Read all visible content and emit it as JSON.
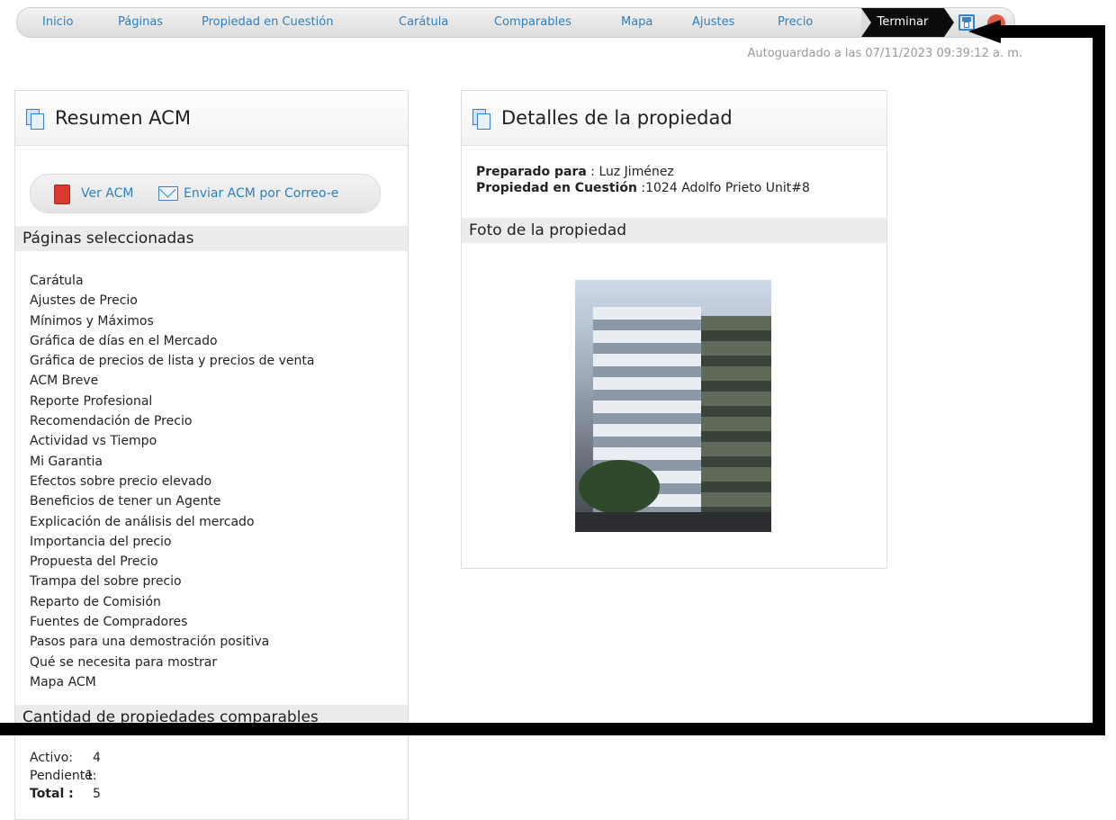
{
  "wizard": {
    "steps": [
      "Inicio",
      "Páginas",
      "Propiedad en Cuestión",
      "Carátula",
      "Comparables",
      "Mapa",
      "Ajustes",
      "Precio"
    ],
    "current": "Terminar",
    "save_icon": "save-icon",
    "close_icon": "close-icon"
  },
  "autosave": "Autoguardado a las 07/11/2023 09:39:12 a. m.",
  "summary": {
    "title": "Resumen ACM",
    "view_label": "Ver ACM",
    "email_label": "Enviar ACM por Correo-e",
    "pages_heading": "Páginas seleccionadas",
    "pages": [
      "Carátula",
      "Ajustes de Precio",
      "Mínimos y Máximos",
      "Gráfica de días en el Mercado",
      "Gráfica de precios de lista y precios de venta",
      "ACM Breve",
      "Reporte Profesional",
      "Recomendación de Precio",
      "Actividad vs Tiempo",
      "Mi Garantia",
      "Efectos sobre precio elevado",
      "Beneficios de tener un Agente",
      "Explicación de análisis del mercado",
      "Importancia del precio",
      "Propuesta del Precio",
      "Trampa del sobre precio",
      "Reparto de Comisión",
      "Fuentes de Compradores",
      "Pasos para una demostración positiva",
      "Qué se necesita para mostrar",
      "Mapa ACM"
    ],
    "counts_heading": "Cantidad de propiedades comparables",
    "counts": {
      "active_label": "Activo:",
      "active_value": "4",
      "pending_label": "Pendiente:",
      "pending_value": "1",
      "total_label": "Total :",
      "total_value": "5"
    }
  },
  "details": {
    "title": "Detalles de la propiedad",
    "prepared_label": "Preparado para",
    "prepared_value": " : Luz Jiménez",
    "property_label": "Propiedad en Cuestión",
    "property_value": " :1024 Adolfo Prieto Unit#8",
    "photo_heading": "Foto de la propiedad"
  },
  "colors": {
    "link": "#2f7fbf",
    "active_step_bg": "#0c0c0c",
    "section_bar": "#ececec",
    "annotation": "#000000"
  }
}
